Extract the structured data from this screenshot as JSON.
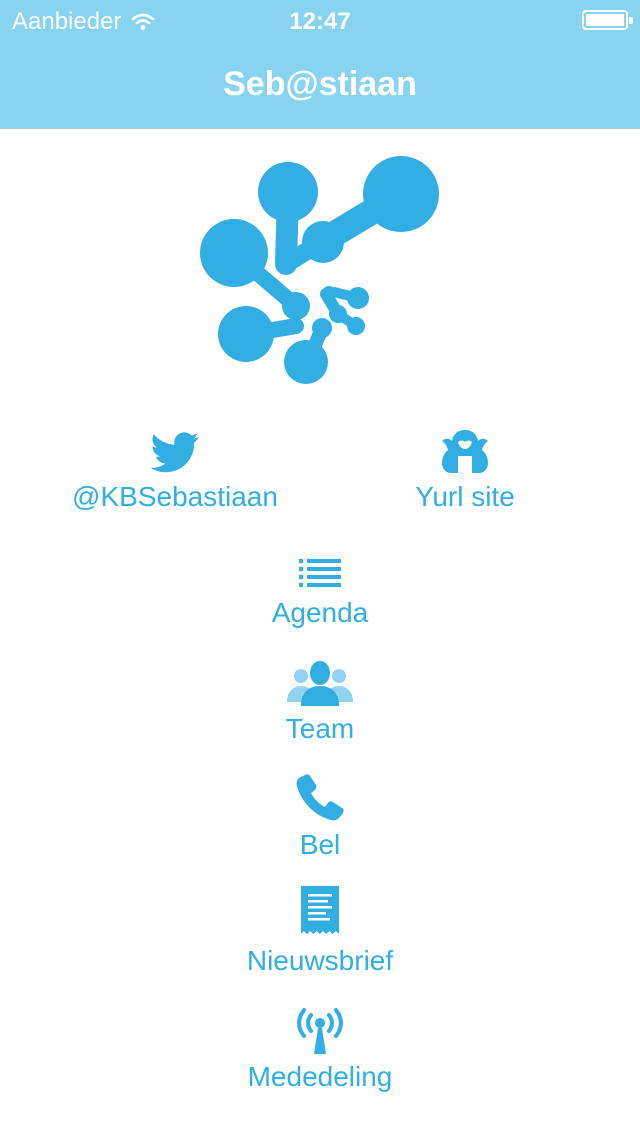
{
  "status_bar": {
    "carrier": "Aanbieder",
    "time": "12:47"
  },
  "header": {
    "title": "Seb@stiaan"
  },
  "menu": {
    "twitter": "@KBSebastiaan",
    "yurl": "Yurl site",
    "agenda": "Agenda",
    "team": "Team",
    "bel": "Bel",
    "nieuwsbrief": "Nieuwsbrief",
    "mededeling": "Mededeling"
  },
  "icons": [
    "twitter-bird-icon",
    "yurl-mascot-icon",
    "list-icon",
    "team-icon",
    "phone-icon",
    "newsletter-icon",
    "broadcast-antenna-icon"
  ],
  "colors": {
    "header": "#87d3f0",
    "accent": "#32aee2"
  }
}
